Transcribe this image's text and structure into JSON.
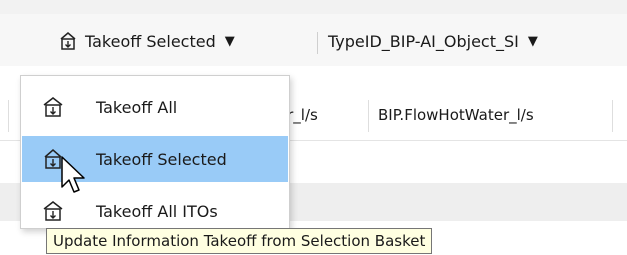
{
  "toolbar": {
    "takeoff_selected_label": "Takeoff Selected",
    "typeid_dropdown_value": "TypeID_BIP-AI_Object_SI"
  },
  "table_headers": [
    "ter_l/s",
    "BIP.FlowHotWater_l/s"
  ],
  "dropdown_menu": {
    "items": [
      {
        "label": "Takeoff All",
        "icon": "takeoff-all-icon",
        "selected": false
      },
      {
        "label": "Takeoff Selected",
        "icon": "takeoff-selected-icon",
        "selected": true
      },
      {
        "label": "Takeoff All ITOs",
        "icon": "takeoff-all-itos-icon",
        "selected": false
      }
    ]
  },
  "tooltip": "Update Information Takeoff from Selection Basket",
  "colors": {
    "highlight": "#99cbf7",
    "tooltip_bg": "#ffffe1"
  }
}
